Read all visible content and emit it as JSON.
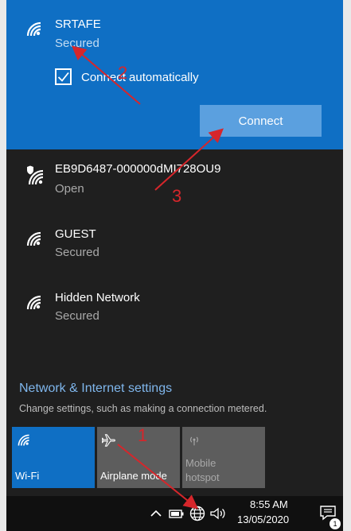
{
  "selected_network": {
    "name": "SRTAFE",
    "status": "Secured",
    "auto_connect_label": "Connect automatically",
    "auto_connect_checked": true,
    "connect_label": "Connect"
  },
  "networks": [
    {
      "name": "EB9D6487-000000dMI728OU9",
      "status": "Open",
      "icon": "wifi-shield-icon"
    },
    {
      "name": "GUEST",
      "status": "Secured",
      "icon": "wifi-icon"
    },
    {
      "name": "Hidden Network",
      "status": "Secured",
      "icon": "wifi-icon"
    }
  ],
  "settings": {
    "link": "Network & Internet settings",
    "description": "Change settings, such as making a connection metered."
  },
  "quick_actions": [
    {
      "label": "Wi-Fi",
      "icon": "wifi-icon",
      "active": true
    },
    {
      "label": "Airplane mode",
      "icon": "airplane-icon",
      "active": false
    },
    {
      "label_line1": "Mobile",
      "label_line2": "hotspot",
      "icon": "hotspot-icon",
      "active": false
    }
  ],
  "taskbar": {
    "time": "8:55 AM",
    "date": "13/05/2020",
    "notification_count": "1"
  },
  "annotations": {
    "marker_1": "1",
    "marker_2": "2",
    "marker_3": "3",
    "arrow_color": "#d6262b"
  },
  "colors": {
    "accent": "#0f6fc4",
    "connect_button": "#5ba0df",
    "flyout_bg": "#1f1f1f"
  }
}
